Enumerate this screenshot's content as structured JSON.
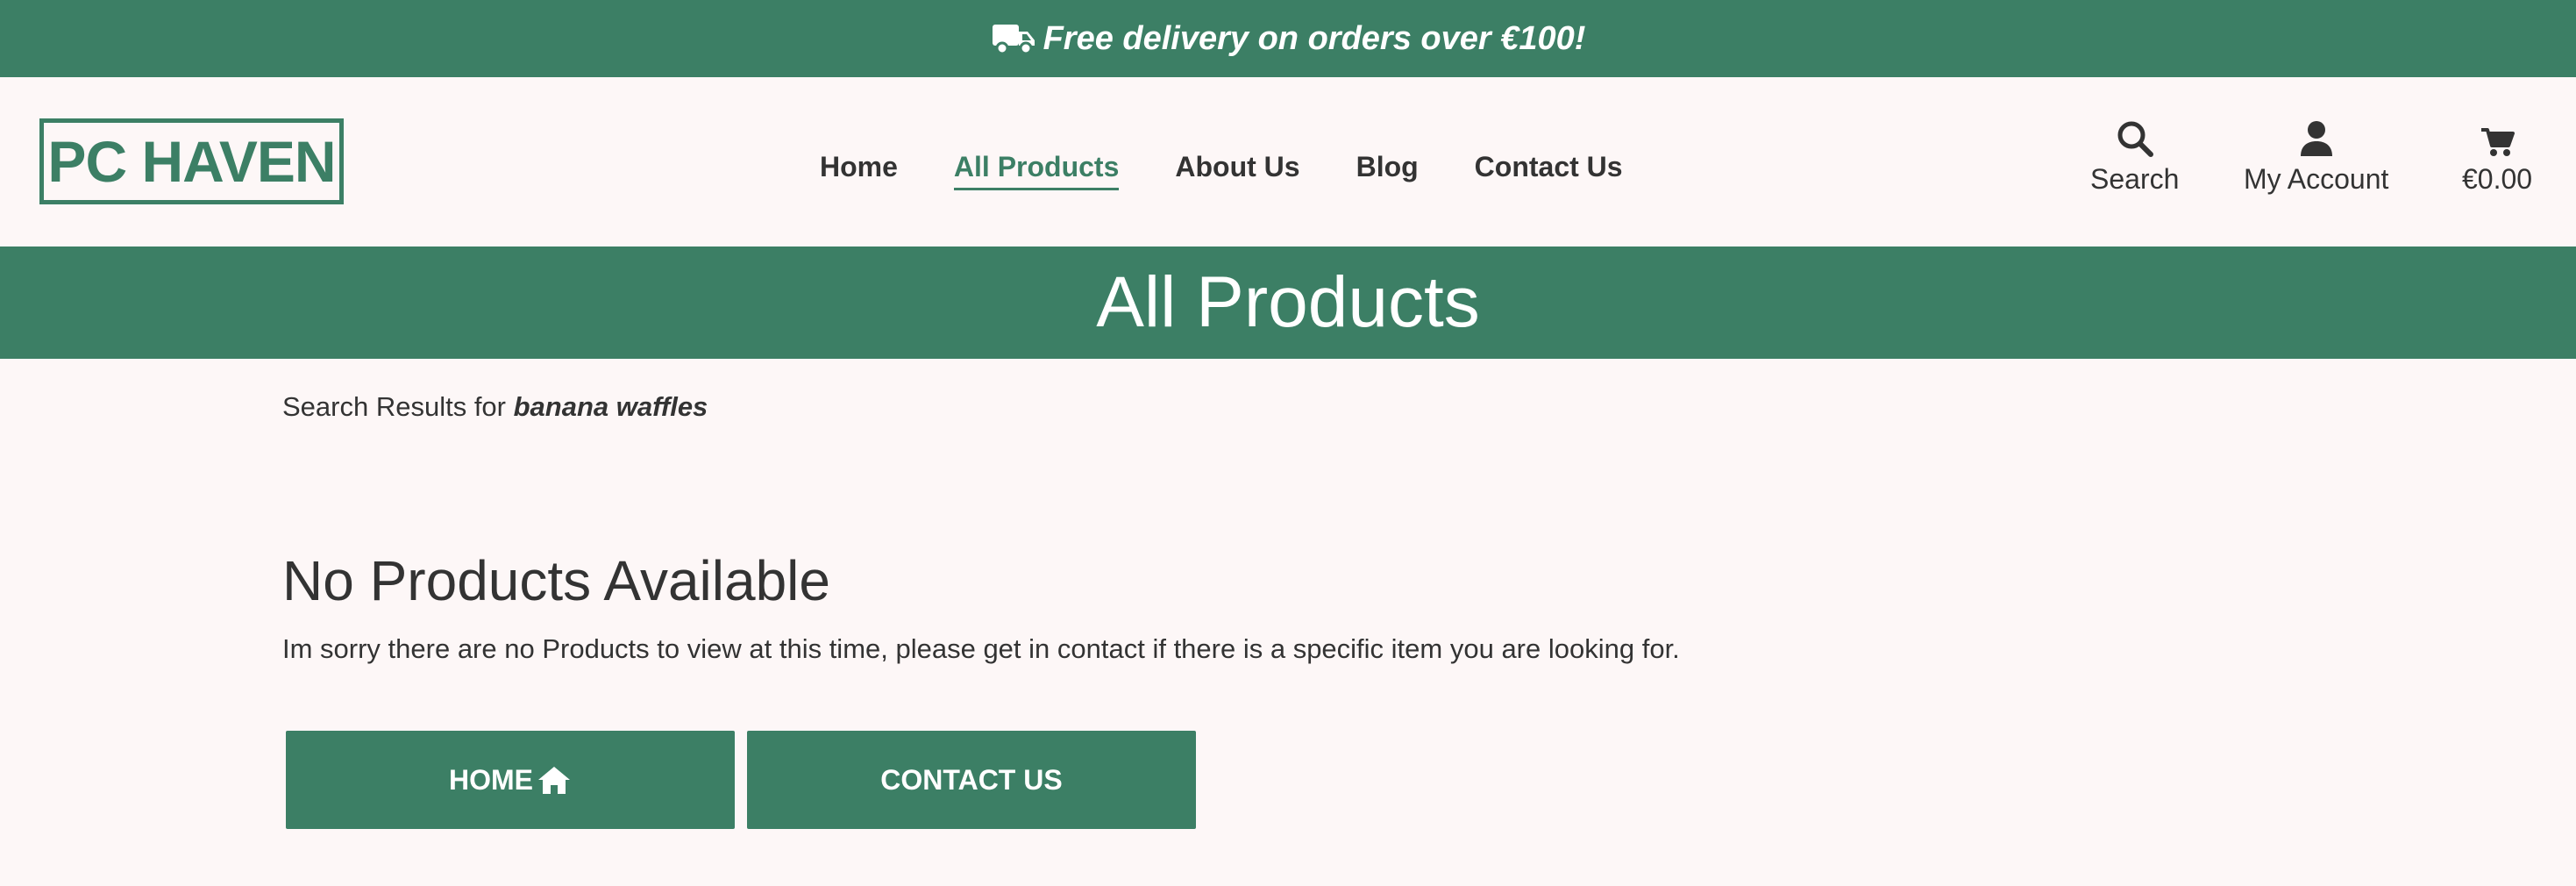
{
  "promo": {
    "icon": "truck-icon",
    "text": "Free delivery on orders over €100!"
  },
  "header": {
    "logo_text": "PC HAVEN",
    "nav": [
      {
        "label": "Home",
        "active": false
      },
      {
        "label": "All Products",
        "active": true
      },
      {
        "label": "About Us",
        "active": false
      },
      {
        "label": "Blog",
        "active": false
      },
      {
        "label": "Contact Us",
        "active": false
      }
    ],
    "tools": {
      "search": {
        "label": "Search",
        "icon": "search-icon"
      },
      "account": {
        "label": "My Account",
        "icon": "user-icon"
      },
      "cart": {
        "label": "€0.00",
        "icon": "cart-icon"
      }
    }
  },
  "banner": {
    "title": "All Products"
  },
  "results": {
    "prefix": "Search Results for",
    "query": "banana waffles"
  },
  "empty_state": {
    "title": "No Products Available",
    "message": "Im sorry there are no Products to view at this time, please get in contact if there is a specific item you are looking for."
  },
  "actions": {
    "home_label": "HOME",
    "home_icon": "home-icon",
    "contact_label": "CONTACT US"
  },
  "colors": {
    "brand_green": "#3c7f65",
    "page_background": "#fdf7f7",
    "text": "#333333"
  }
}
